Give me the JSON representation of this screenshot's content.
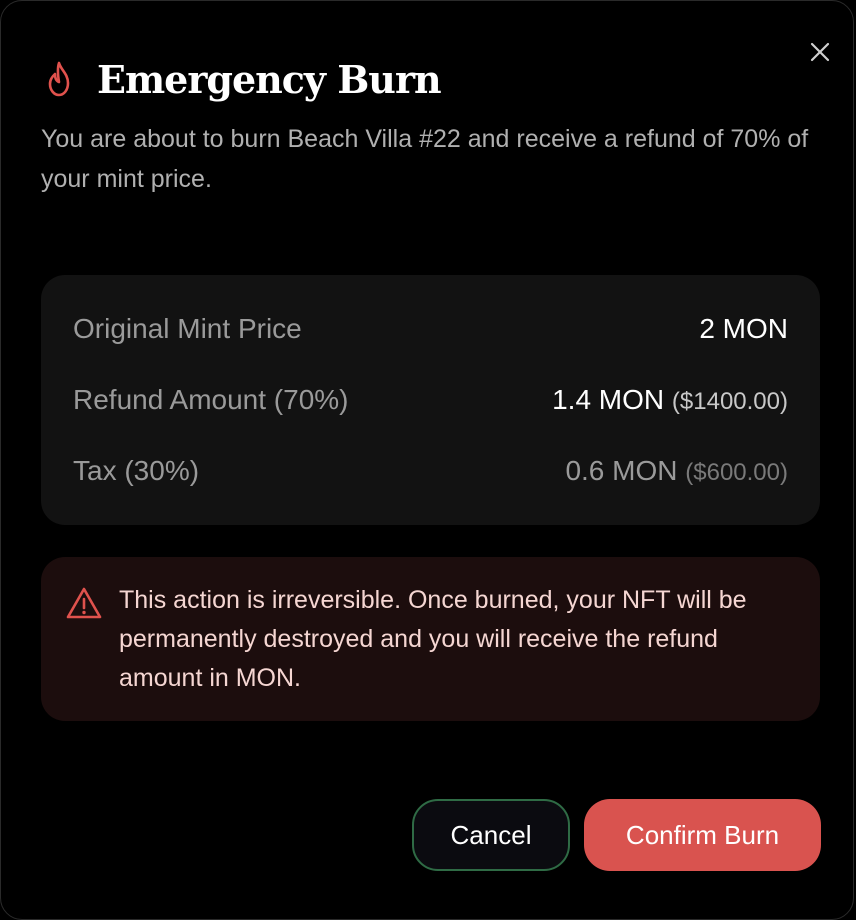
{
  "dialog": {
    "title": "Emergency Burn",
    "subtitle": "You are about to burn Beach Villa #22 and receive a refund of 70% of your mint price.",
    "icons": {
      "title_icon": "flame-icon",
      "close_icon": "close-icon",
      "warning_icon": "warning-triangle-icon"
    }
  },
  "summary": {
    "rows": [
      {
        "label": "Original Mint Price",
        "value": "2 MON",
        "usd": ""
      },
      {
        "label": "Refund Amount (70%)",
        "value": "1.4 MON",
        "usd": "($1400.00)"
      },
      {
        "label": "Tax (30%)",
        "value": "0.6 MON",
        "usd": "($600.00)"
      }
    ]
  },
  "warning": {
    "text": "This action is irreversible. Once burned, your NFT will be permanently destroyed and you will receive the refund amount in MON."
  },
  "actions": {
    "cancel_label": "Cancel",
    "confirm_label": "Confirm Burn"
  },
  "colors": {
    "background": "#000000",
    "panel": "#121212",
    "warning_bg": "#1c0d0d",
    "accent_red": "#d9534f",
    "cancel_border": "#2f6b45"
  }
}
